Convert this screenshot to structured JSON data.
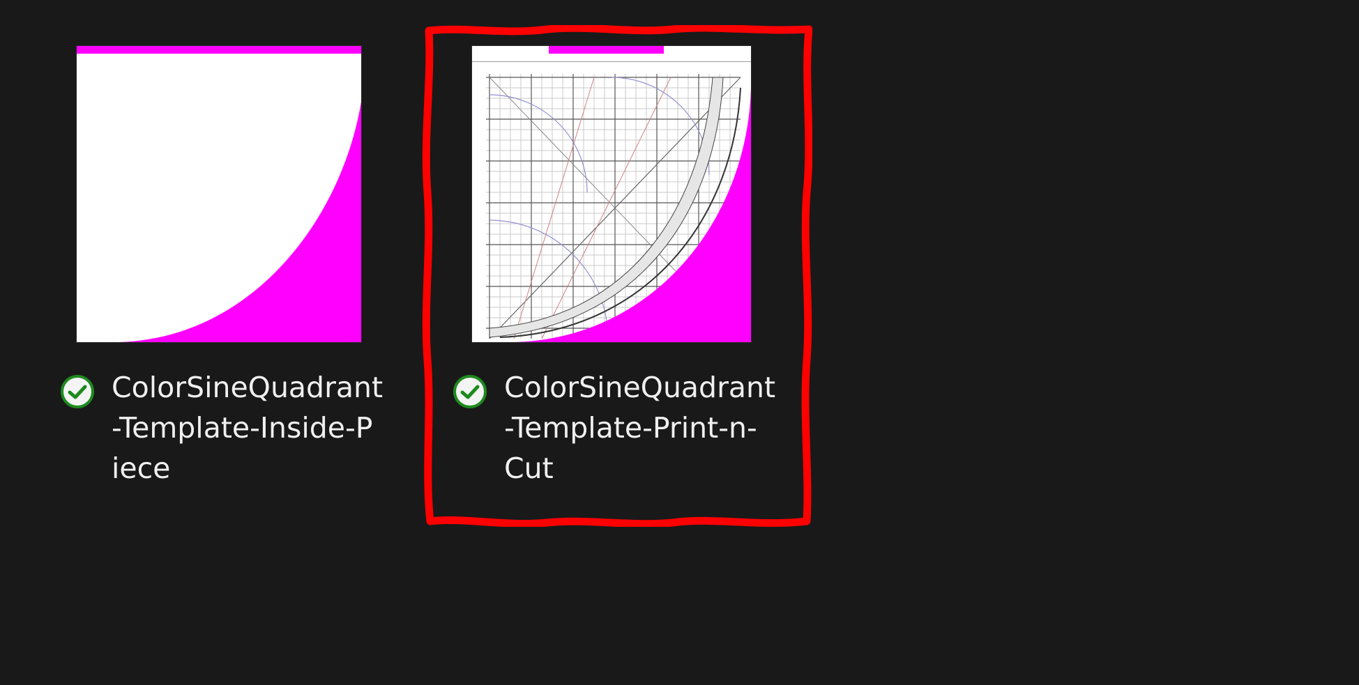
{
  "files": [
    {
      "name_line1": "ColorSineQuadrant",
      "name_line2": "-Template-Inside-P",
      "name_line3": "iece",
      "thumbnail": "quadrant-inside-piece",
      "status_icon": "sync-complete-check-icon"
    },
    {
      "name_line1": "ColorSineQuadrant",
      "name_line2": "-Template-Print-n-",
      "name_line3": "Cut",
      "thumbnail": "quadrant-print-n-cut",
      "status_icon": "sync-complete-check-icon"
    }
  ],
  "colors": {
    "background": "#191919",
    "accent_magenta": "#ff00ff",
    "highlight_red": "#ff0000",
    "check_green": "#107c10",
    "text": "#f0f0f0"
  },
  "selected_file_index": 1
}
